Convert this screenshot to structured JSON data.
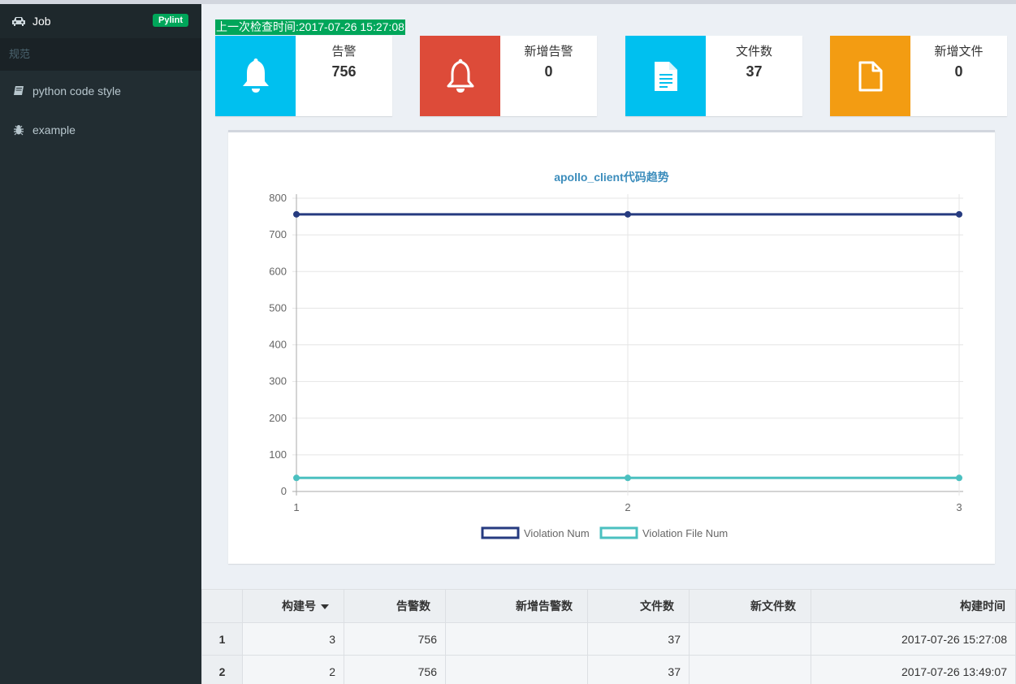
{
  "sidebar": {
    "job_label": "Job",
    "job_badge": "Pylint",
    "section_header": "规范",
    "items": [
      {
        "label": "python code style",
        "icon": "book-icon"
      },
      {
        "label": "example",
        "icon": "bug-icon"
      }
    ]
  },
  "main": {
    "last_check": "上一次检查时间:2017-07-26 15:27:08",
    "cards": [
      {
        "label": "告警",
        "value": "756",
        "color": "#00c0ef",
        "icon": "bell-icon"
      },
      {
        "label": "新增告警",
        "value": "0",
        "color": "#dd4b39",
        "icon": "bell-outline-icon"
      },
      {
        "label": "文件数",
        "value": "37",
        "color": "#00c0ef",
        "icon": "file-text-icon"
      },
      {
        "label": "新增文件",
        "value": "0",
        "color": "#f39c12",
        "icon": "file-outline-icon"
      }
    ]
  },
  "chart_data": {
    "type": "line",
    "title": "apollo_client代码趋势",
    "x": [
      "1",
      "2",
      "3"
    ],
    "ylim": [
      0,
      800
    ],
    "yticks": [
      0,
      100,
      200,
      300,
      400,
      500,
      600,
      700,
      800
    ],
    "grid": true,
    "legend_position": "bottom",
    "series": [
      {
        "name": "Violation Num",
        "values": [
          756,
          756,
          756
        ],
        "color": "#263b80"
      },
      {
        "name": "Violation File Num",
        "values": [
          37,
          37,
          37
        ],
        "color": "#4bc0c0"
      }
    ]
  },
  "table": {
    "headers": [
      "构建号",
      "告警数",
      "新增告警数",
      "文件数",
      "新文件数",
      "构建时间"
    ],
    "rows": [
      {
        "index": "1",
        "cells": [
          "3",
          "756",
          "",
          "37",
          "",
          "2017-07-26 15:27:08"
        ]
      },
      {
        "index": "2",
        "cells": [
          "2",
          "756",
          "",
          "37",
          "",
          "2017-07-26 13:49:07"
        ]
      }
    ]
  }
}
